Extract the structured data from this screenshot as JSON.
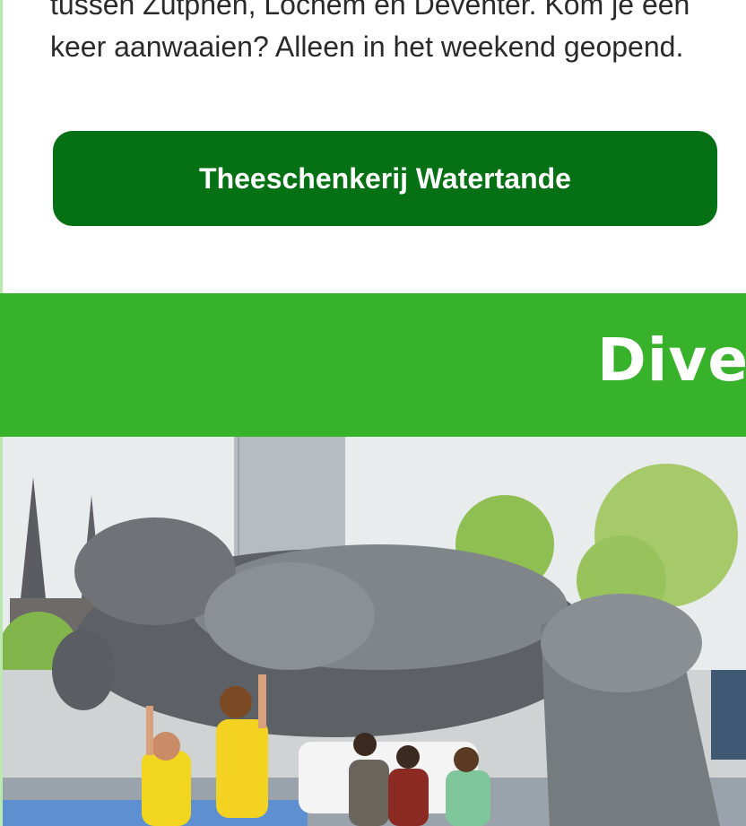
{
  "card": {
    "description": "tussen Zutphen, Lochem en Deventer. Kom je een keer aanwaaien? Alleen in het weekend geopend.",
    "button_label": "Theeschenkerij Watertande"
  },
  "section": {
    "title": "Dive"
  },
  "colors": {
    "button_green": "#057014",
    "header_green": "#37b22a",
    "text": "#2a2a2a"
  }
}
